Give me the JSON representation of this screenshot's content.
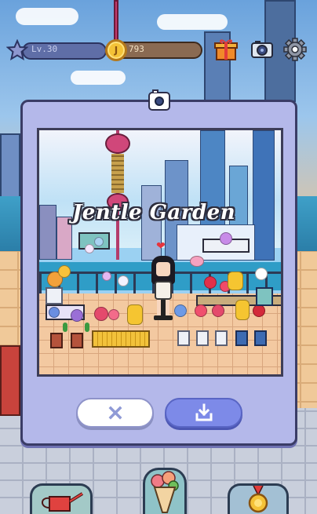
{
  "hud": {
    "level_label": "Lv.30",
    "coins": "793",
    "coin_symbol": "J",
    "icons": [
      "star-icon",
      "gift-box-icon",
      "camera-icon",
      "gear-icon"
    ]
  },
  "modal": {
    "header_icon": "camera-icon",
    "photo": {
      "title": "Jentle Garden",
      "scene": [
        "city-skyline",
        "oriental-pearl-tower",
        "river",
        "flower-stall",
        "character",
        "heart-icon"
      ]
    },
    "buttons": {
      "close_icon": "close-x-icon",
      "save_icon": "download-icon"
    }
  },
  "bottom_bar": {
    "icons": [
      "watering-can-icon",
      "flower-bouquet-icon",
      "medal-icon"
    ]
  },
  "colors": {
    "modal_bg": "#b4b8ea",
    "save_button": "#7d8ae8",
    "close_button": "#ffffff",
    "coin": "#f4c237"
  }
}
